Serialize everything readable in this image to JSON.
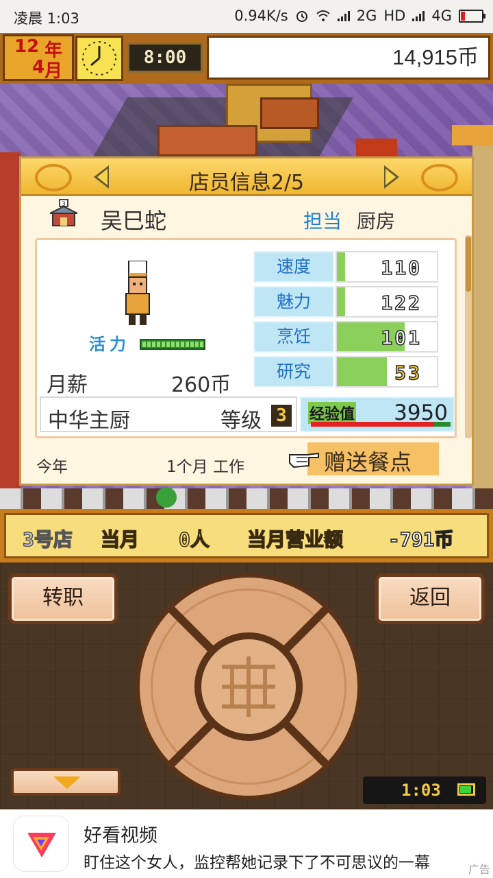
{
  "status_bar": {
    "time": "凌晨 1:03",
    "network_speed": "0.94K/s",
    "network_2g": "2G",
    "hd": "HD",
    "network_4g": "4G",
    "battery_level": 0.2
  },
  "top_bar": {
    "year": "12",
    "year_unit": "年",
    "month": "4",
    "month_unit": "月",
    "time": "8:00",
    "money": "14,915币"
  },
  "panel": {
    "title": "店员信息2/5",
    "staff_name": "吴巳蛇",
    "role_label": "担当",
    "role_value": "厨房",
    "vitality_label": "活力",
    "vitality_level": 1.0,
    "salary_label": "月薪",
    "salary_value": "260币",
    "stats": [
      {
        "name": "速度",
        "value": "110",
        "fill": 0.08,
        "gold": false
      },
      {
        "name": "魅力",
        "value": "122",
        "fill": 0.08,
        "gold": false
      },
      {
        "name": "烹饪",
        "value": "101",
        "fill": 0.68,
        "gold": false
      },
      {
        "name": "研究",
        "value": "53",
        "fill": 0.5,
        "gold": true
      }
    ],
    "chef_title": "中华主厨",
    "level_label": "等级",
    "level_value": "3",
    "exp_label": "经验值",
    "exp_value": "3950",
    "exp_progress": 0.88,
    "year_label": "今年",
    "work_label": "1个月 工作",
    "gift_button": "赠送餐点"
  },
  "store_bar": {
    "store": "3号店",
    "month_label": "当月",
    "customers": "0人",
    "revenue_label": "当月营业额",
    "revenue": "-791币"
  },
  "controls": {
    "transfer_button": "转职",
    "back_button": "返回",
    "mini_clock": "1:03"
  },
  "ad": {
    "title": "好看视频",
    "description": "盯住这个女人，监控帮她记录下了不可思议的一幕",
    "tag": "广告"
  }
}
